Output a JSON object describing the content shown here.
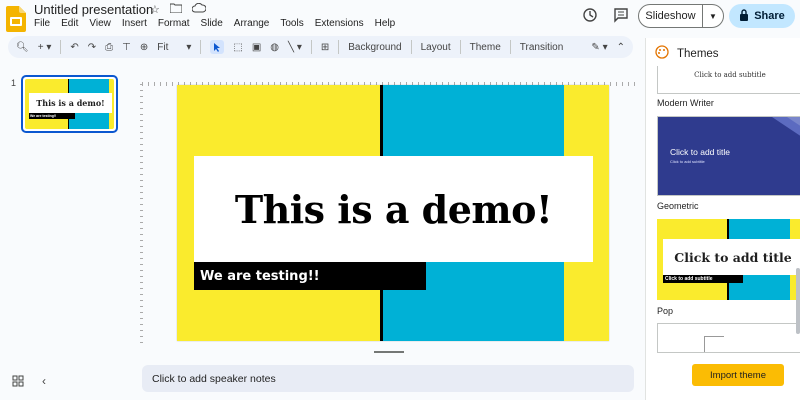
{
  "app": {
    "title": "Untitled presentation"
  },
  "menu": [
    "File",
    "Edit",
    "View",
    "Insert",
    "Format",
    "Slide",
    "Arrange",
    "Tools",
    "Extensions",
    "Help"
  ],
  "header": {
    "slideshow_label": "Slideshow",
    "share_label": "Share"
  },
  "toolbar": {
    "zoom_value": "Fit",
    "background": "Background",
    "layout": "Layout",
    "theme": "Theme",
    "transition": "Transition"
  },
  "filmstrip": {
    "slide_number": "1",
    "thumb_title": "This is a demo!",
    "thumb_subtitle": "We are testing!!"
  },
  "slide": {
    "title": "This is a demo!",
    "subtitle": "We are testing!!"
  },
  "notes": {
    "placeholder": "Click to add speaker notes"
  },
  "themes_panel": {
    "title": "Themes",
    "themes": [
      {
        "name": "Modern Writer",
        "preview_subtitle": "Click to add subtitle"
      },
      {
        "name": "Geometric",
        "preview_title": "Click to add title",
        "preview_subtitle": "Click to add subtitle"
      },
      {
        "name": "Pop",
        "preview_title": "Click to add title",
        "preview_subtitle": "Click to add subtitle"
      }
    ],
    "import_label": "Import theme"
  },
  "colors": {
    "accent_blue": "#0b57d0",
    "share_bg": "#c2e7ff",
    "slide_yellow": "#faeb2d",
    "slide_cyan": "#00b1d6",
    "import_yellow": "#fbbc04",
    "geometric_navy": "#2f3b8e"
  }
}
